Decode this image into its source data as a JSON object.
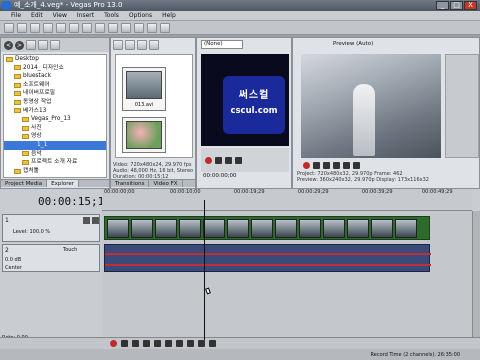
{
  "window": {
    "title": "예_소개_4.veg* - Vegas Pro 13.0",
    "minimize": "_",
    "maximize": "□",
    "close": "X"
  },
  "menu": [
    "File",
    "Edit",
    "View",
    "Insert",
    "Tools",
    "Options",
    "Help"
  ],
  "explorer": {
    "back": "<",
    "forward": ">",
    "tree": [
      {
        "label": "Desktop",
        "type": "folder",
        "depth": 0
      },
      {
        "label": "2014_ 디자인쇼",
        "type": "folder",
        "depth": 1
      },
      {
        "label": "bluestack",
        "type": "folder",
        "depth": 1
      },
      {
        "label": "소프트웨어",
        "type": "folder",
        "depth": 1
      },
      {
        "label": "네이버프로필",
        "type": "folder",
        "depth": 1
      },
      {
        "label": "동영상 작업",
        "type": "folder",
        "depth": 1
      },
      {
        "label": "베가스13",
        "type": "folder",
        "depth": 1
      },
      {
        "label": "Vegas_Pro_13",
        "type": "folder",
        "depth": 2
      },
      {
        "label": "사진",
        "type": "folder",
        "depth": 2
      },
      {
        "label": "영상",
        "type": "folder",
        "depth": 2
      },
      {
        "label": "1_1",
        "type": "file",
        "depth": 3
      },
      {
        "label": "음악",
        "type": "folder",
        "depth": 2
      },
      {
        "label": "프로젝트 소개 자료",
        "type": "folder",
        "depth": 2
      },
      {
        "label": "캡처툴",
        "type": "folder",
        "depth": 1
      }
    ],
    "tabs": [
      "Project Media",
      "Explorer",
      "Transitions",
      "Video FX"
    ]
  },
  "media": {
    "clip_label": "013.avi",
    "info": [
      "Video: 720x480x24, 29.970 fps",
      "Audio: 48,000 Hz, 16 bit, Stereo",
      "Duration: 00:00:15;12"
    ]
  },
  "trimmer": {
    "dropdown": "(None)",
    "watermark_line1": "써스컬",
    "watermark_line2": "cscul.com",
    "timecode": "00:00:00;00"
  },
  "preview": {
    "mode": "Preview (Auto)",
    "info": [
      "Project: 720x480x32, 29.970p   Frame: 462",
      "Preview: 360x240x32, 29.970p   Display: 173x116x32"
    ]
  },
  "timeline": {
    "timecode": "00:00:15;12",
    "ruler_marks": [
      "00:00:00;00",
      "00:00:10;00",
      "00:00:19;29",
      "00:00:29;29",
      "00:00:39;29",
      "00:00:49;29"
    ],
    "video_track": {
      "number": "1",
      "level": "Level: 100.0 %"
    },
    "audio_track": {
      "number": "2",
      "volume": "0.0 dB",
      "pan": "Center",
      "touch": "Touch"
    },
    "rate": "Rate: 0.00",
    "status": "Record Time (2 channels): 26:35:00"
  }
}
